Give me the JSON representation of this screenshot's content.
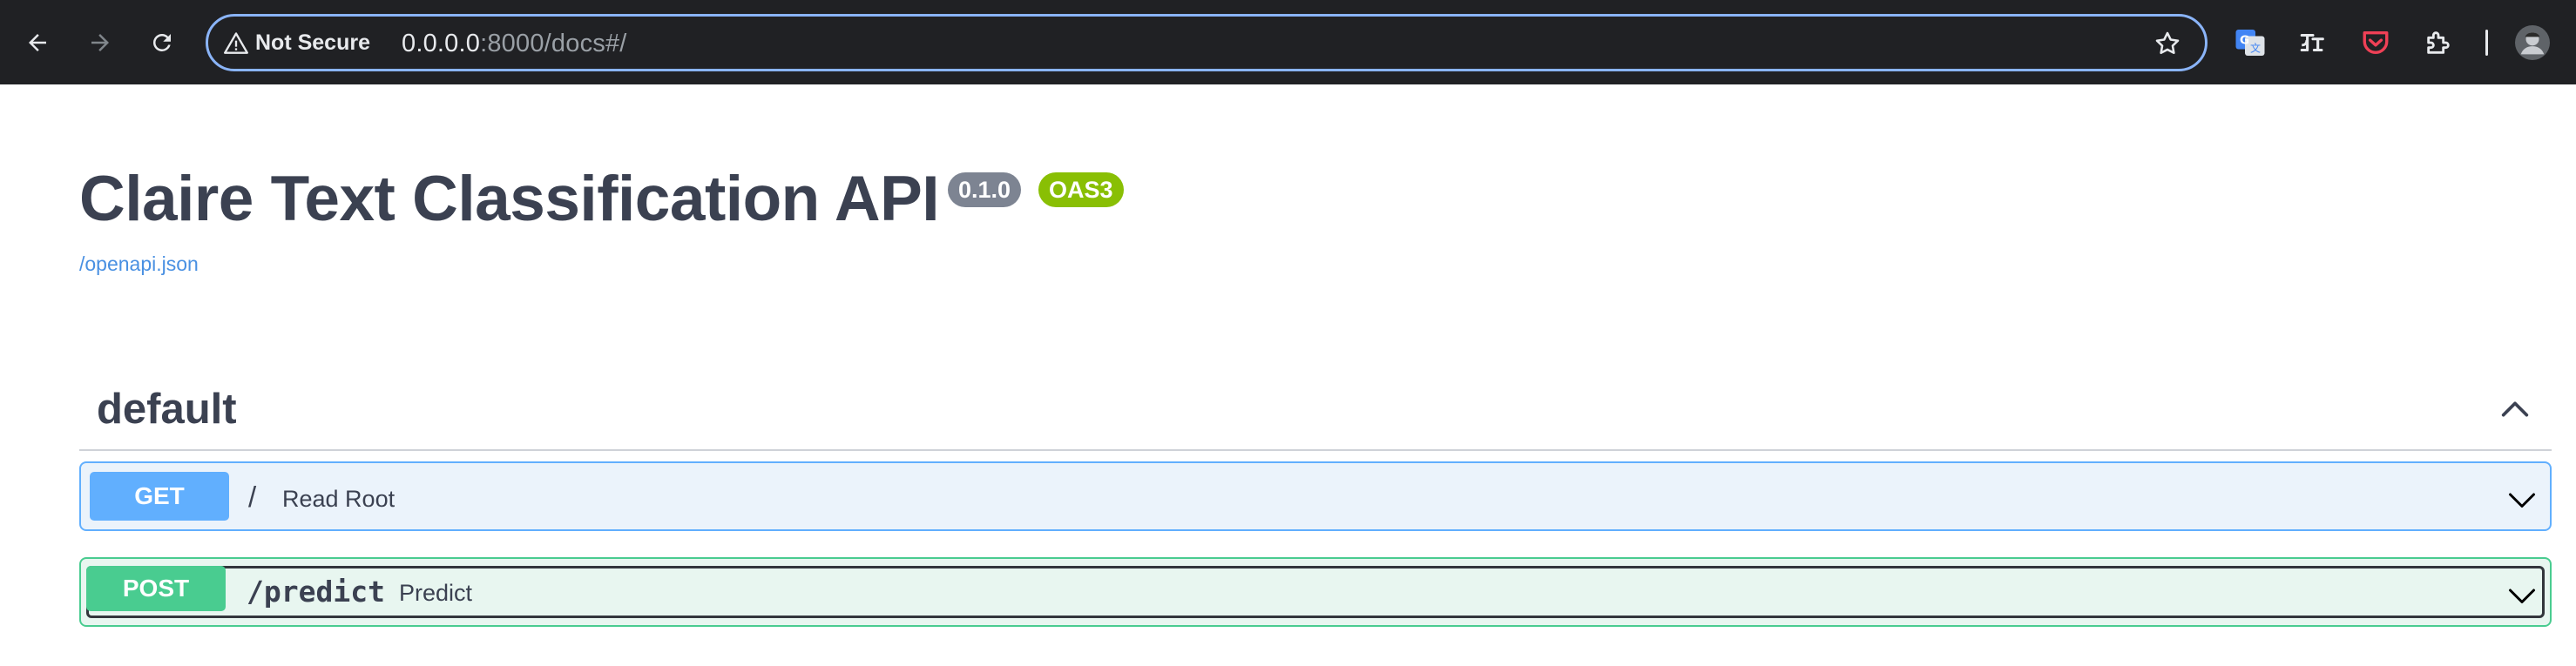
{
  "browser": {
    "security_chip": "Not Secure",
    "url_host": "0.0.0.0",
    "url_rest": ":8000/docs#/",
    "icons": [
      "back-icon",
      "forward-icon",
      "reload-icon",
      "warning-icon",
      "star-icon",
      "google-translate-icon",
      "extension-icon",
      "pocket-icon",
      "puzzle-icon",
      "profile-avatar"
    ]
  },
  "page": {
    "title": "Claire Text Classification API",
    "version_badge": "0.1.0",
    "oas_badge": "OAS3",
    "spec_link": "/openapi.json",
    "tag": "default",
    "operations": [
      {
        "method": "GET",
        "path": "/",
        "summary": "Read Root"
      },
      {
        "method": "POST",
        "path": "/predict",
        "summary": "Predict"
      }
    ]
  },
  "colors": {
    "get": "#61affe",
    "post": "#49cc90",
    "version_badge": "#7d8492",
    "oas_badge": "#89bf04",
    "link": "#4990e2",
    "toolbar": "#202124",
    "focus_ring": "#8ab4f8"
  }
}
